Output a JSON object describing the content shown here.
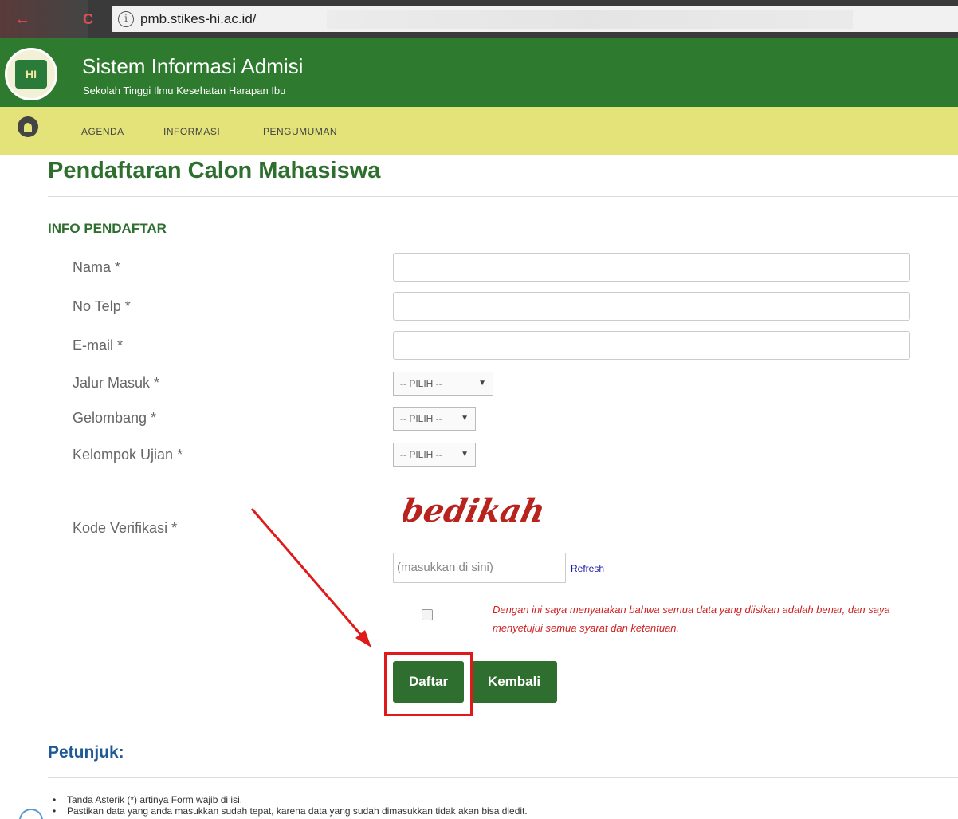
{
  "browser": {
    "url": "pmb.stikes-hi.ac.id/",
    "back_icon": "←",
    "reload_icon": "C",
    "info_icon": "i"
  },
  "header": {
    "title": "Sistem Informasi Admisi",
    "subtitle": "Sekolah Tinggi Ilmu Kesehatan Harapan Ibu",
    "logo_text": "HI"
  },
  "nav": {
    "items": [
      "AGENDA",
      "INFORMASI",
      "PENGUMUMAN"
    ]
  },
  "page": {
    "title": "Pendaftaran Calon Mahasiswa",
    "section_title": "INFO PENDAFTAR"
  },
  "form": {
    "nama_label": "Nama *",
    "telp_label": "No Telp *",
    "email_label": "E-mail *",
    "jalur_label": "Jalur Masuk *",
    "gelombang_label": "Gelombang *",
    "kelompok_label": "Kelompok Ujian *",
    "kode_label": "Kode Verifikasi *",
    "select_default": "-- PILIH --",
    "captcha_text": "bedikah",
    "verif_placeholder": "(masukkan di sini)",
    "refresh_label": "Refresh",
    "agree_text": "Dengan ini saya menyatakan bahwa semua data yang diisikan adalah benar, dan saya menyetujui semua syarat dan ketentuan.",
    "submit_label": "Daftar",
    "back_label": "Kembali"
  },
  "petunjuk": {
    "title": "Petunjuk:",
    "notes": [
      "Tanda Asterik (*) artinya Form wajib di isi.",
      "Pastikan data yang anda masukkan sudah tepat, karena data yang sudah dimasukkan tidak akan bisa diedit."
    ]
  },
  "colors": {
    "header_green": "#2e7a2e",
    "nav_yellow": "#e4e37a",
    "button_green": "#2e6e2e",
    "annotation_red": "#e01a1a",
    "petunjuk_blue": "#1f5a96"
  }
}
